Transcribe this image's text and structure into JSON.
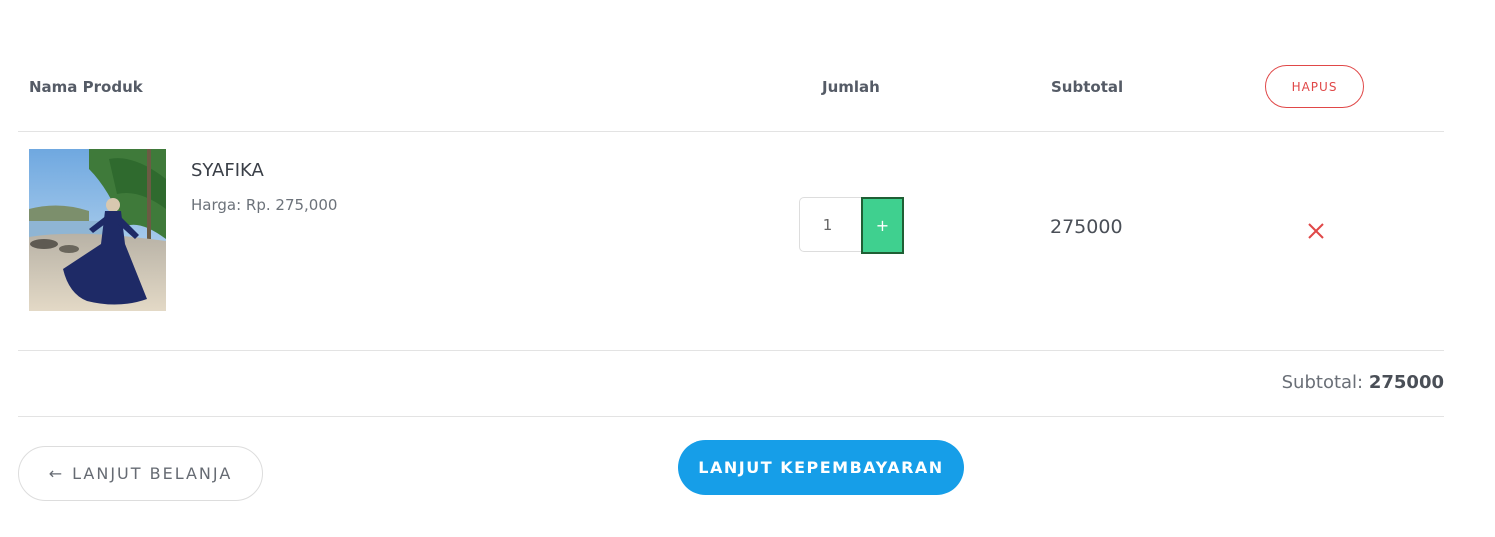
{
  "table": {
    "headers": {
      "product": "Nama Produk",
      "quantity": "Jumlah",
      "subtotal": "Subtotal"
    },
    "clear_label": "HAPUS"
  },
  "items": [
    {
      "name": "SYAFIKA",
      "price_label": "Harga",
      "price_sep": ": ",
      "price_value": "Rp. 275,000",
      "quantity": "1",
      "subtotal": "275000",
      "image": "woman-in-navy-dress-on-beach"
    }
  ],
  "cart": {
    "subtotal_label": "Subtotal:",
    "subtotal_value": "275000"
  },
  "actions": {
    "continue_shopping": "LANJUT BELANJA",
    "checkout": "LANJUT KEPEMBAYARAN"
  },
  "icons": {
    "plus": "+",
    "back_arrow": "←",
    "remove": "close-icon"
  },
  "colors": {
    "accent": "#169ee8",
    "danger": "#e04848",
    "plus_button": "#3fd08f"
  }
}
